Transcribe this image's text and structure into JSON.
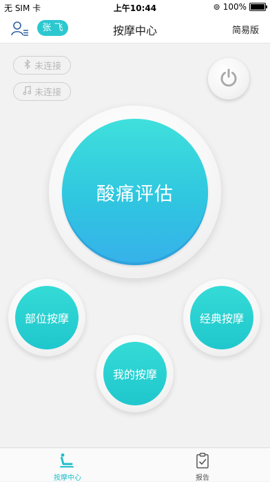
{
  "status_bar": {
    "carrier": "无 SIM 卡",
    "time": "上午10:44",
    "battery": "100%"
  },
  "nav": {
    "user_name": "张 飞",
    "title": "按摩中心",
    "simple_mode": "简易版"
  },
  "connections": {
    "bluetooth_status": "未连接",
    "music_status": "未连接"
  },
  "main": {
    "evaluate_label": "酸痛评估",
    "body_part_label": "部位按摩",
    "classic_label": "经典按摩",
    "my_massage_label": "我的按摩"
  },
  "tabs": {
    "center_label": "按摩中心",
    "report_label": "报告"
  },
  "colors": {
    "accent": "#2cc8d0",
    "active_tab": "#1fbfc9",
    "inactive_tab": "#555555"
  },
  "icons": {
    "user": "user-list-icon",
    "bluetooth": "bluetooth-icon",
    "music": "music-note-icon",
    "power": "power-icon",
    "tab_center": "massage-chair-icon",
    "tab_report": "clipboard-check-icon"
  }
}
